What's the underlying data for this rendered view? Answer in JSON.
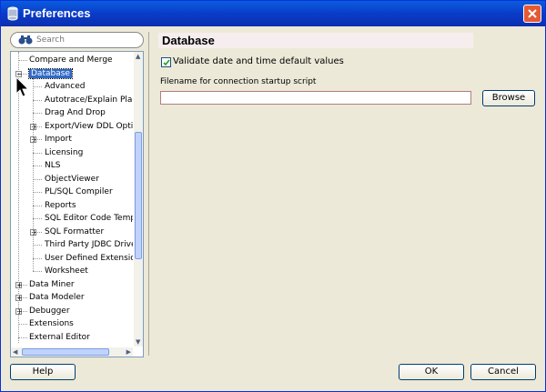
{
  "window": {
    "title": "Preferences"
  },
  "search": {
    "placeholder": "Search"
  },
  "tree": {
    "items": [
      {
        "label": "Compare and Merge",
        "level": 0,
        "expander": "none"
      },
      {
        "label": "Database",
        "level": 0,
        "expander": "minus",
        "selected": true
      },
      {
        "label": "Advanced",
        "level": 1,
        "expander": "none"
      },
      {
        "label": "Autotrace/Explain Plan",
        "level": 1,
        "expander": "none"
      },
      {
        "label": "Drag And Drop",
        "level": 1,
        "expander": "none"
      },
      {
        "label": "Export/View DDL Option",
        "level": 1,
        "expander": "plus"
      },
      {
        "label": "Import",
        "level": 1,
        "expander": "plus"
      },
      {
        "label": "Licensing",
        "level": 1,
        "expander": "none"
      },
      {
        "label": "NLS",
        "level": 1,
        "expander": "none"
      },
      {
        "label": "ObjectViewer",
        "level": 1,
        "expander": "none"
      },
      {
        "label": "PL/SQL Compiler",
        "level": 1,
        "expander": "none"
      },
      {
        "label": "Reports",
        "level": 1,
        "expander": "none"
      },
      {
        "label": "SQL Editor Code Templa",
        "level": 1,
        "expander": "none"
      },
      {
        "label": "SQL Formatter",
        "level": 1,
        "expander": "plus"
      },
      {
        "label": "Third Party JDBC Driver",
        "level": 1,
        "expander": "none"
      },
      {
        "label": "User Defined Extension",
        "level": 1,
        "expander": "none"
      },
      {
        "label": "Worksheet",
        "level": 1,
        "expander": "none"
      },
      {
        "label": "Data Miner",
        "level": 0,
        "expander": "plus"
      },
      {
        "label": "Data Modeler",
        "level": 0,
        "expander": "plus"
      },
      {
        "label": "Debugger",
        "level": 0,
        "expander": "plus"
      },
      {
        "label": "Extensions",
        "level": 0,
        "expander": "none"
      },
      {
        "label": "External Editor",
        "level": 0,
        "expander": "none"
      }
    ]
  },
  "panel": {
    "title": "Database",
    "checkbox_label": "Validate date and time default values",
    "checkbox_checked": true,
    "field_label": "Filename for connection startup script",
    "field_value": "",
    "browse_label": "Browse"
  },
  "footer": {
    "help_label": "Help",
    "ok_label": "OK",
    "cancel_label": "Cancel"
  },
  "colors": {
    "titlebar": "#0a50d0",
    "selection": "#316ac5",
    "header_bg": "#f6eeee"
  }
}
